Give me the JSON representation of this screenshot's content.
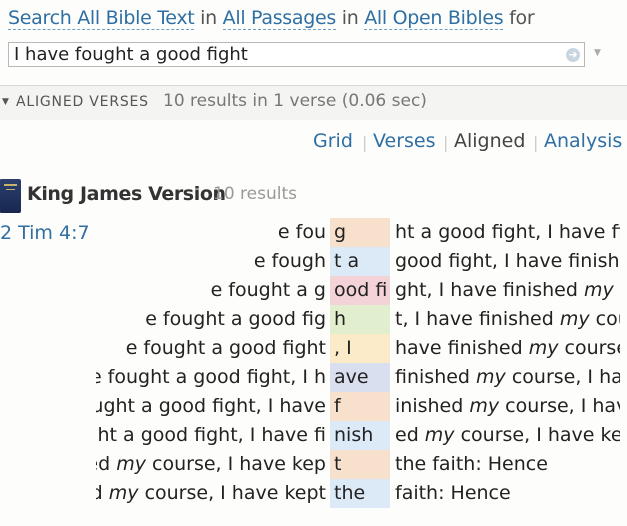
{
  "header": {
    "search_link": "Search All Bible Text",
    "in1": "in",
    "passages_link": "All Passages",
    "in2": "in",
    "bibles_link": "All Open Bibles",
    "for": "for",
    "query": "I have fought a good fight"
  },
  "section": {
    "title": "ALIGNED VERSES",
    "summary": "10 results in 1 verse (0.06 sec)"
  },
  "tabs": [
    "Grid",
    "Verses",
    "Aligned",
    "Analysis"
  ],
  "active_tab": "Aligned",
  "version": {
    "name": "King James Version",
    "count": "10 results",
    "reference": "2 Tim 4:7"
  },
  "rows": [
    {
      "left": "e fou",
      "mid": "g",
      "right": "ht a good fight, I have fin",
      "color": "#f8e1cc"
    },
    {
      "left": "e fough",
      "mid": "t a",
      "right": "good fight, I have finished",
      "color": "#dce9f7"
    },
    {
      "left": "e fought a g",
      "mid": "ood fi",
      "right": "ght, I have finished |my| course",
      "color": "#f3d3d8"
    },
    {
      "left": "e fought a good fig",
      "mid": "h",
      "right": "t, I have finished |my| course",
      "color": "#e1efcf"
    },
    {
      "left": "e fought a good fight",
      "mid": ", I",
      "right": "have finished |my| course, I",
      "color": "#fcebc8"
    },
    {
      "left": "I have fought a good fight, I h",
      "mid": "ave",
      "right": "finished |my| course, I have",
      "color": "#d9dfee"
    },
    {
      "left": "I have fought a good fight, I have",
      "mid": "f",
      "right": "inished |my| course, I have",
      "color": "#f8e1cc"
    },
    {
      "left": "I have fought a good fight, I have fi",
      "mid": "nish",
      "right": "ed |my| course, I have kept",
      "color": "#dce9f7"
    },
    {
      "left": "I have finished |my| course, I have kep",
      "mid": "t",
      "right": "the faith: Hence",
      "color": "#f8e1cc"
    },
    {
      "left": "I have finished |my| course, I have kept",
      "mid": "the",
      "right": "faith: Hence",
      "color": "#dce9f7"
    }
  ]
}
